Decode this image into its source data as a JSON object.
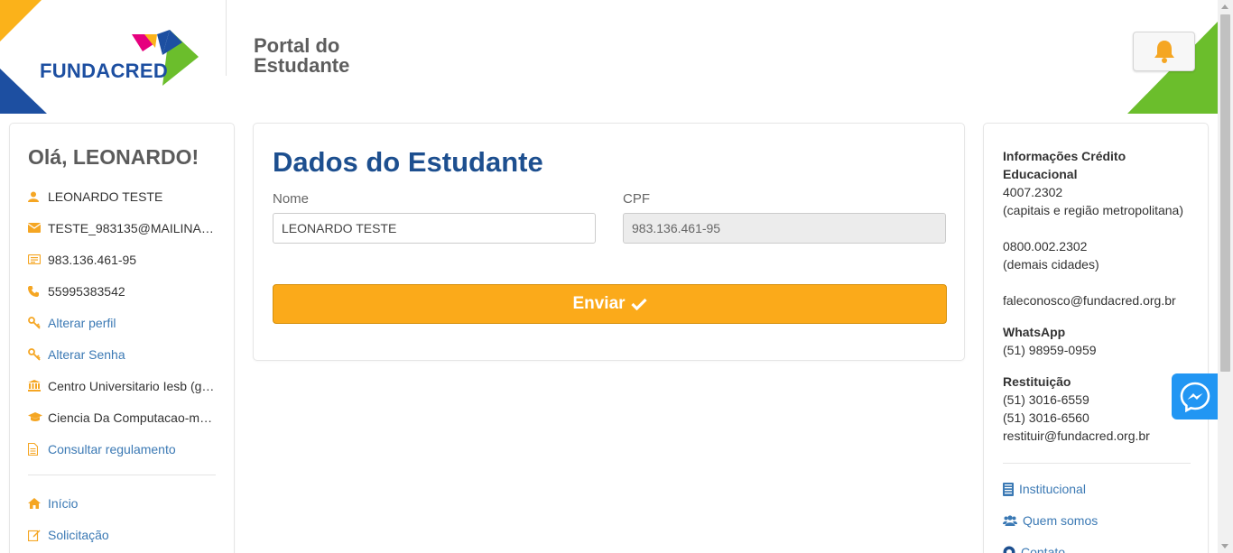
{
  "header": {
    "logo_text": "FUNDACRED",
    "portal_title_line1": "Portal do",
    "portal_title_line2": "Estudante"
  },
  "sidebar": {
    "greeting": "Olá, LEONARDO!",
    "items": [
      {
        "icon": "user-icon",
        "label": "LEONARDO TESTE",
        "link": false
      },
      {
        "icon": "envelope-icon",
        "label": "TESTE_983135@MAILINA…",
        "link": false
      },
      {
        "icon": "id-card-icon",
        "label": "983.136.461-95",
        "link": false
      },
      {
        "icon": "phone-icon",
        "label": "55995383542",
        "link": false
      },
      {
        "icon": "key-icon",
        "label": "Alterar perfil",
        "link": true
      },
      {
        "icon": "key-icon",
        "label": "Alterar Senha",
        "link": true
      },
      {
        "icon": "university-icon",
        "label": "Centro Universitario Iesb (g…",
        "link": false
      },
      {
        "icon": "graduation-cap-icon",
        "label": "Ciencia Da Computacao-m…",
        "link": false
      },
      {
        "icon": "document-icon",
        "label": "Consultar regulamento",
        "link": true
      }
    ],
    "nav": [
      {
        "icon": "home-icon",
        "label": "Início"
      },
      {
        "icon": "edit-icon",
        "label": "Solicitação"
      }
    ]
  },
  "main": {
    "title": "Dados do Estudante",
    "nome_label": "Nome",
    "nome_value": "LEONARDO TESTE",
    "cpf_label": "CPF",
    "cpf_value": "983.136.461-95",
    "submit_label": "Enviar"
  },
  "right": {
    "credit_title_line1": "Informações Crédito",
    "credit_title_line2": "Educacional",
    "phone1": "4007.2302",
    "phone1_note": "(capitais e região metropolitana)",
    "phone2": "0800.002.2302",
    "phone2_note": "(demais cidades)",
    "email": "faleconosco@fundacred.org.br",
    "whatsapp_title": "WhatsApp",
    "whatsapp": "(51) 98959-0959",
    "restituicao_title": "Restituição",
    "rest_phone1": "(51) 3016-6559",
    "rest_phone2": "(51) 3016-6560",
    "rest_email": "restituir@fundacred.org.br",
    "links": [
      {
        "icon": "building-icon",
        "label": "Institucional"
      },
      {
        "icon": "users-icon",
        "label": "Quem somos"
      },
      {
        "icon": "contact-icon",
        "label": "Contato"
      }
    ]
  },
  "colors": {
    "accent": "#fbaa1a",
    "title_blue": "#1d4f8f",
    "link_blue": "#3b79b4",
    "icon_orange": "#f5a623"
  }
}
